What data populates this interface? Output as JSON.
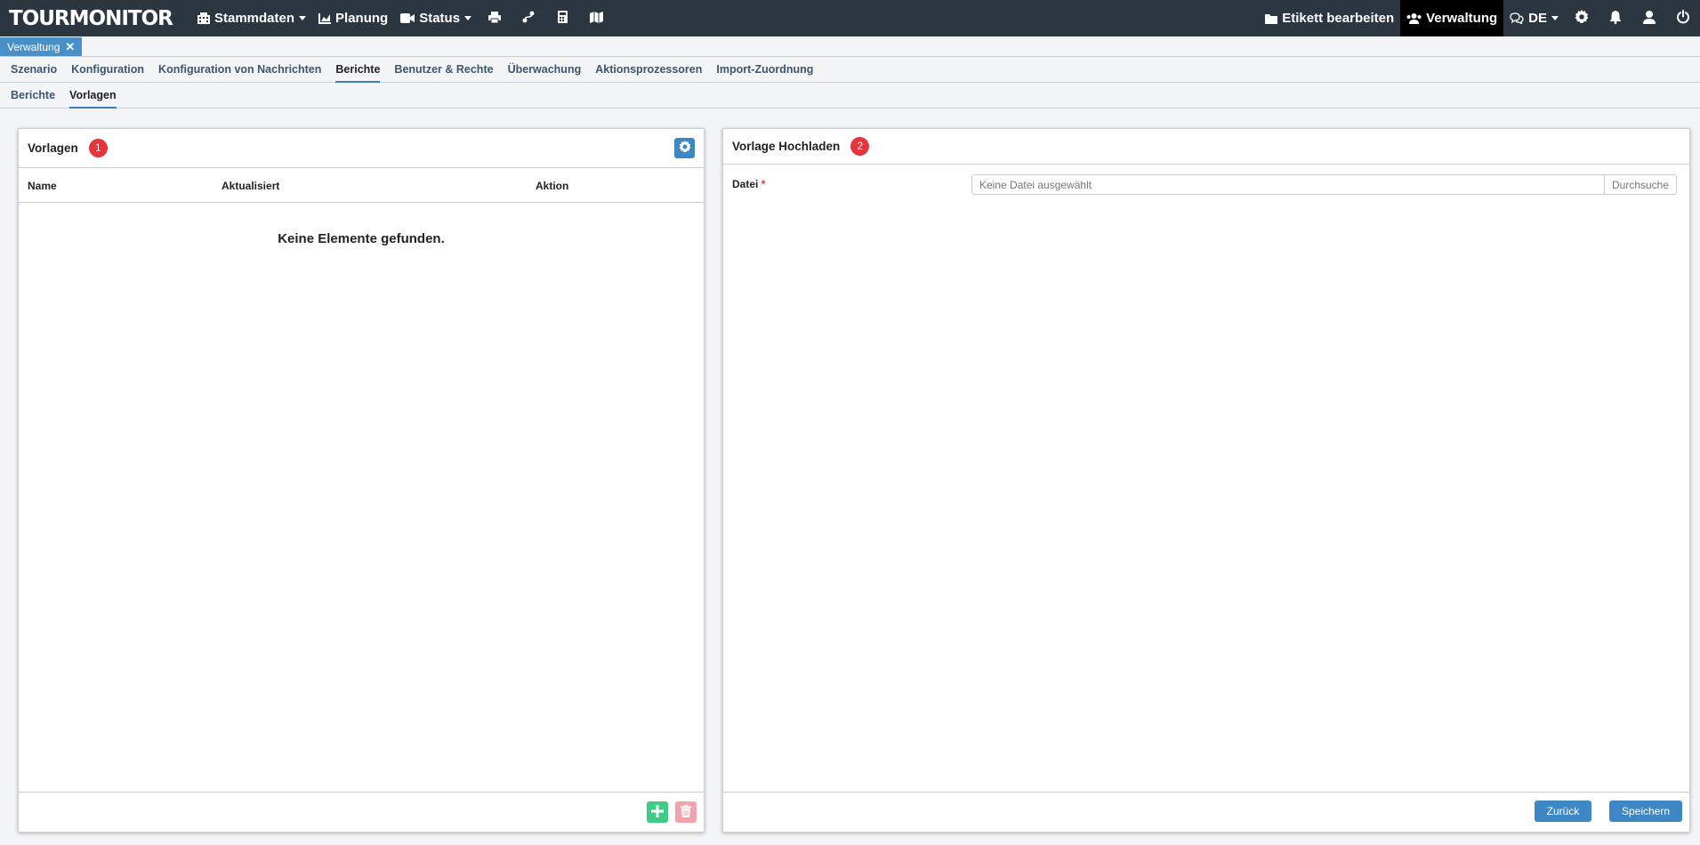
{
  "app": {
    "logo": "TOURMONITOR"
  },
  "topnav": {
    "stammdaten": "Stammdaten",
    "planung": "Planung",
    "status": "Status",
    "etikett": "Etikett bearbeiten",
    "verwaltung": "Verwaltung",
    "language": "DE",
    "icons": [
      "building-icon",
      "chart-icon",
      "video-icon",
      "print-icon",
      "route-icon",
      "calculator-icon",
      "map-icon",
      "folder-icon",
      "users-icon",
      "chat-icon",
      "gear-icon",
      "bell-icon",
      "user-icon",
      "power-icon"
    ]
  },
  "doctab": {
    "label": "Verwaltung",
    "close": "✕"
  },
  "mainnav": {
    "tabs": [
      "Szenario",
      "Konfiguration",
      "Konfiguration von Nachrichten",
      "Berichte",
      "Benutzer & Rechte",
      "Überwachung",
      "Aktionsprozessoren",
      "Import-Zuordnung"
    ],
    "active": "Berichte"
  },
  "subnav": {
    "tabs": [
      "Berichte",
      "Vorlagen"
    ],
    "active": "Vorlagen"
  },
  "left_panel": {
    "title": "Vorlagen",
    "badge": "1",
    "columns": {
      "name": "Name",
      "updated": "Aktualisiert",
      "action": "Aktion"
    },
    "empty": "Keine Elemente gefunden."
  },
  "right_panel": {
    "title": "Vorlage Hochladen",
    "badge": "2",
    "file_label": "Datei",
    "required_mark": "*",
    "file_placeholder": "Keine Datei ausgewählt",
    "browse": "Durchsuche",
    "back": "Zurück",
    "save": "Speichern"
  },
  "colors": {
    "topbar": "#2b3640",
    "accent": "#3d87c4",
    "badge": "#e3353a",
    "add": "#3ecb84",
    "delete": "#f2a4ad"
  }
}
